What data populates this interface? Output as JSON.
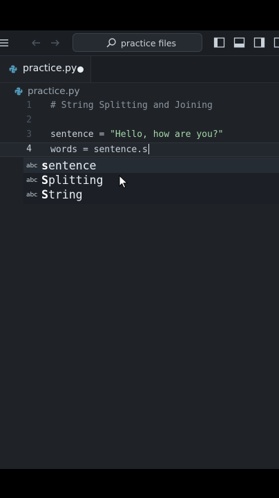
{
  "titlebar": {
    "search_label": "practice files"
  },
  "tabs": [
    {
      "label": "practice.py",
      "dirty": true
    }
  ],
  "breadcrumb": {
    "file": "practice.py"
  },
  "editor": {
    "lines": [
      {
        "no": "1",
        "comment": "# String Splitting and Joining"
      },
      {
        "no": "2"
      },
      {
        "no": "3",
        "var": "sentence",
        "op": " = ",
        "string": "\"Hello, how are you?\""
      },
      {
        "no": "4",
        "text": "words = sentence.s",
        "current": true
      }
    ]
  },
  "suggestions": [
    {
      "icon": "abc",
      "label_rest": "entence",
      "match": "s"
    },
    {
      "icon": "abc",
      "label_rest": "plitting",
      "match": "S"
    },
    {
      "icon": "abc",
      "label_rest": "tring",
      "match": "S"
    }
  ],
  "icons": {
    "menu": "menu-icon",
    "back": "arrow-left-icon",
    "forward": "arrow-right-icon",
    "search": "search-icon",
    "file_type": "python-icon"
  },
  "colors": {
    "editor_bg": "#1f2328",
    "string": "#a5d6a7",
    "comment": "#8b949e"
  }
}
